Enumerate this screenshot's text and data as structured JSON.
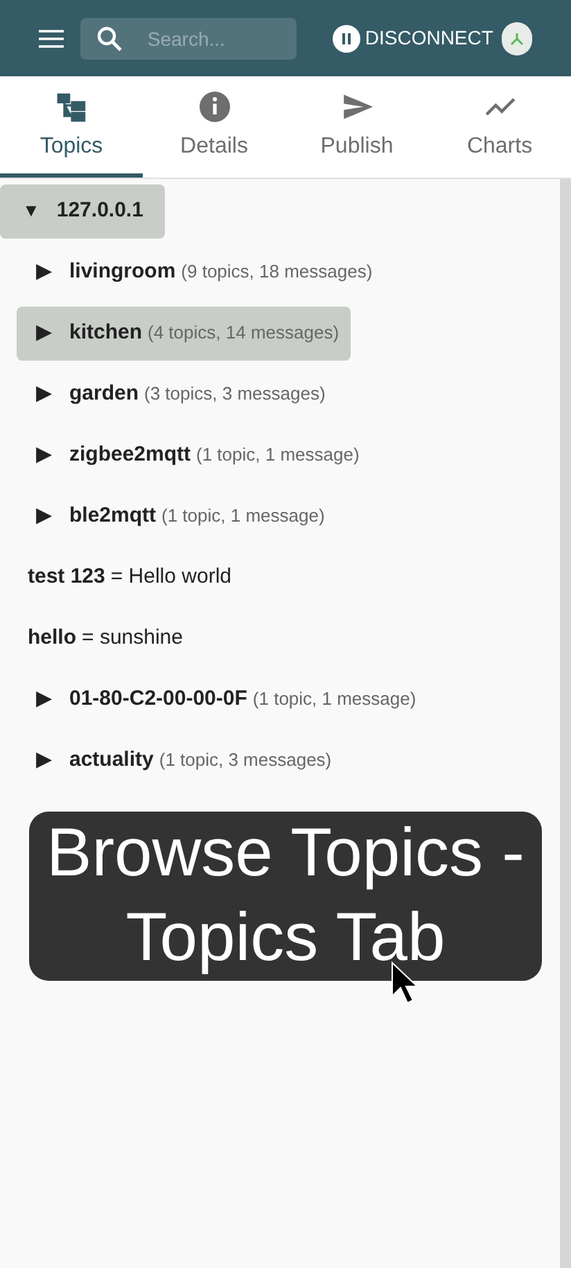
{
  "header": {
    "search": {
      "placeholder": "Search..."
    },
    "disconnect_label": "DISCONNECT"
  },
  "tabs": [
    {
      "label": "Topics",
      "selected": true
    },
    {
      "label": "Details",
      "selected": false
    },
    {
      "label": "Publish",
      "selected": false
    },
    {
      "label": "Charts",
      "selected": false
    }
  ],
  "tree": {
    "toggle": "▼",
    "label": "127.0.0.1",
    "selected": false,
    "children": [
      {
        "kind": "branch",
        "toggle": "▶",
        "label": "livingroom",
        "info": "(9 topics, 18 messages)",
        "selected": false
      },
      {
        "kind": "branch",
        "toggle": "▶",
        "label": "kitchen",
        "info": "(4 topics, 14 messages)",
        "selected": true
      },
      {
        "kind": "branch",
        "toggle": "▶",
        "label": "garden",
        "info": "(3 topics, 3 messages)",
        "selected": false
      },
      {
        "kind": "branch",
        "toggle": "▶",
        "label": "zigbee2mqtt",
        "info": "(1 topic, 1 message)",
        "selected": false
      },
      {
        "kind": "branch",
        "toggle": "▶",
        "label": "ble2mqtt",
        "info": "(1 topic, 1 message)",
        "selected": false
      },
      {
        "kind": "value",
        "label": "test 123",
        "value": "= Hello world",
        "selected": false
      },
      {
        "kind": "value",
        "label": "hello",
        "value": "= sunshine",
        "selected": false
      },
      {
        "kind": "branch",
        "toggle": "▶",
        "label": "01-80-C2-00-00-0F",
        "info": "(1 topic, 1 message)",
        "selected": false
      },
      {
        "kind": "branch",
        "toggle": "▶",
        "label": "actuality",
        "info": "(1 topic, 3 messages)",
        "selected": false
      }
    ]
  },
  "caption": "Browse Topics - Topics Tab"
}
